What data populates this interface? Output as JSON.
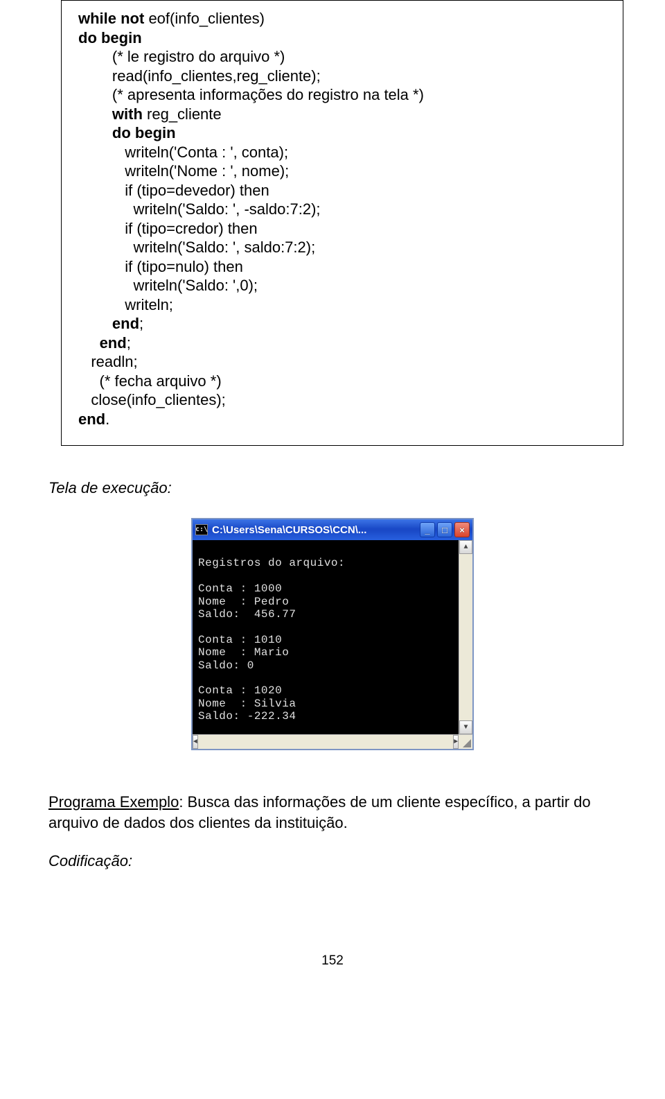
{
  "code": {
    "l1a": "while not",
    "l1b": " eof(info_clientes)",
    "l2a": "do begin",
    "l3": "        (* le registro do arquivo *)",
    "l4": "        read(info_clientes,reg_cliente);",
    "l5": "        (* apresenta informações do registro na tela *)",
    "l6a": "        ",
    "l6b": "with",
    "l6c": " reg_cliente",
    "l7a": "        ",
    "l7b": "do begin",
    "l8": "           writeln('Conta : ', conta);",
    "l9": "           writeln('Nome : ', nome);",
    "l10": "           if (tipo=devedor) then",
    "l11": "             writeln('Saldo: ', -saldo:7:2);",
    "l12": "           if (tipo=credor) then",
    "l13": "             writeln('Saldo: ', saldo:7:2);",
    "l14": "           if (tipo=nulo) then",
    "l15": "             writeln('Saldo: ',0);",
    "l16": "           writeln;",
    "l17a": "        ",
    "l17b": "end",
    "l17c": ";",
    "l18a": "     ",
    "l18b": "end",
    "l18c": ";",
    "l19": "   readln;",
    "l20": "     (* fecha arquivo *)",
    "l21": "   close(info_clientes);",
    "l22a": "end",
    "l22b": "."
  },
  "caption_exec": "Tela de execução",
  "console": {
    "title_icon": "c:\\",
    "title": "C:\\Users\\Sena\\CURSOS\\CCN\\...",
    "min_symbol": "_",
    "max_symbol": "□",
    "close_symbol": "×",
    "up_arrow": "▲",
    "down_arrow": "▼",
    "left_arrow": "◄",
    "right_arrow": "►",
    "lines": [
      "",
      "Registros do arquivo:",
      "",
      "Conta : 1000",
      "Nome  : Pedro",
      "Saldo:  456.77",
      "",
      "Conta : 1010",
      "Nome  : Mario",
      "Saldo: 0",
      "",
      "Conta : 1020",
      "Nome  : Silvia",
      "Saldo: -222.34",
      ""
    ]
  },
  "body": {
    "label": "Programa Exemplo",
    "text": ": Busca das informações de um cliente específico, a partir do arquivo de dados dos clientes da instituição."
  },
  "codif_label": "Codificação",
  "codif_colon": ":",
  "page_number": "152"
}
